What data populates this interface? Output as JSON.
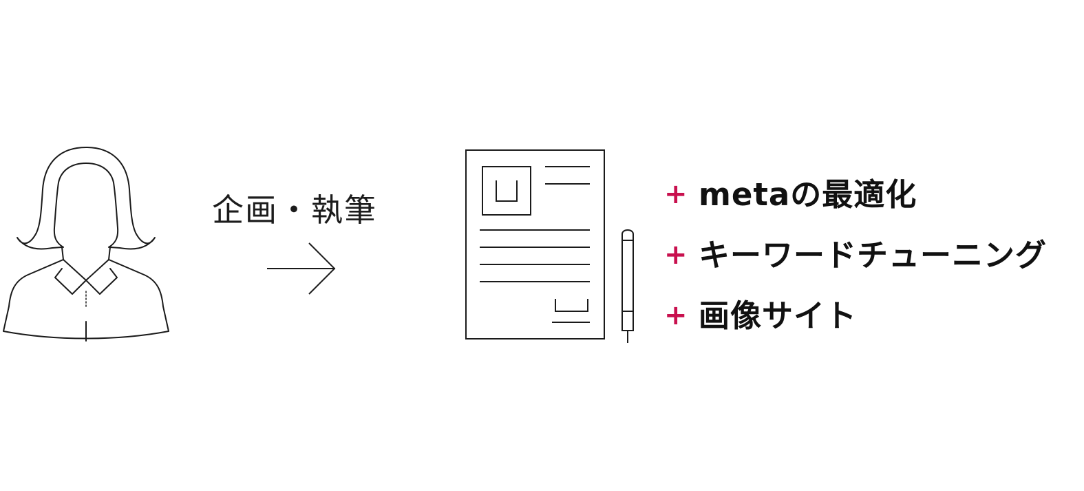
{
  "flow": {
    "step_label": "企画・執筆"
  },
  "features": [
    {
      "prefix": "+",
      "text": "metaの最適化"
    },
    {
      "prefix": "+",
      "text": "キーワードチューニング"
    },
    {
      "prefix": "+",
      "text": "画像サイト"
    }
  ],
  "colors": {
    "accent": "#c8104e",
    "text": "#111111",
    "line": "#1a1a1a"
  },
  "icons": {
    "person": "woman-silhouette-icon",
    "arrow": "arrow-right-icon",
    "document": "document-icon",
    "pen": "pen-icon"
  }
}
